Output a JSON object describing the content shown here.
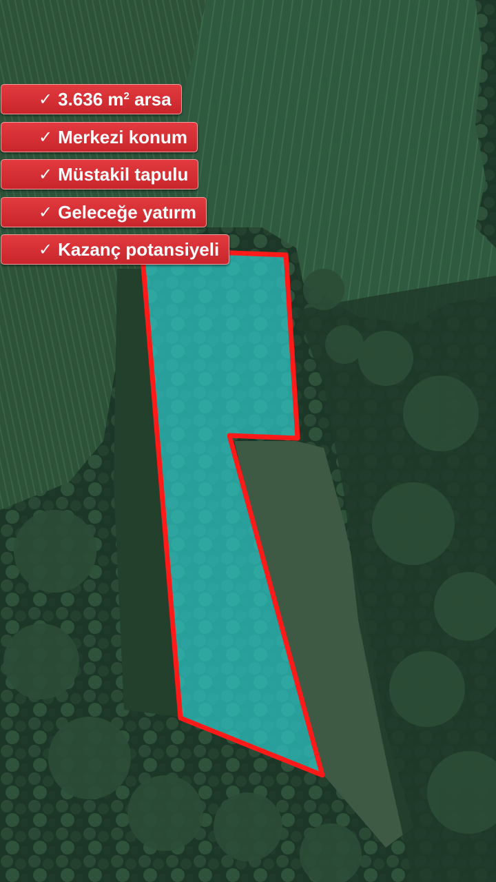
{
  "badges": [
    {
      "check": "✓",
      "text": "3.636 m",
      "sup": "2",
      "suffix": " arsa"
    },
    {
      "check": "✓",
      "text": "Merkezi konum"
    },
    {
      "check": "✓",
      "text": "Müstakil tapulu"
    },
    {
      "check": "✓",
      "text": "Geleceğe yatırm"
    },
    {
      "check": "✓",
      "text": "Kazanç potansiyeli"
    }
  ],
  "colors": {
    "badge_red": "#d12f35",
    "parcel_fill": "#2ec8c8",
    "parcel_outline": "#ff1a1a",
    "forest": "#1e3a2a",
    "field": "#2e5a3e"
  }
}
